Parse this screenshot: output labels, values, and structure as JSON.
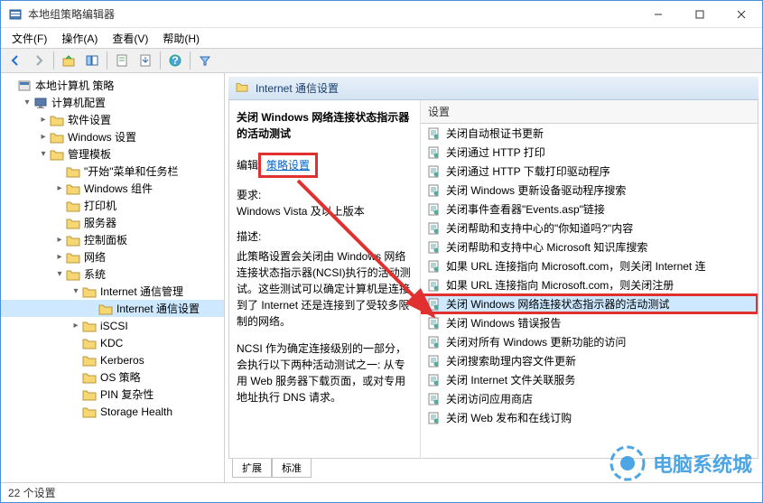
{
  "window": {
    "title": "本地组策略编辑器"
  },
  "menu": {
    "items": [
      "文件(F)",
      "操作(A)",
      "查看(V)",
      "帮助(H)"
    ]
  },
  "tree": {
    "root": "本地计算机 策略",
    "nodes": [
      {
        "indent": 0,
        "expander": " ",
        "icon": "console",
        "label": "本地计算机 策略"
      },
      {
        "indent": 1,
        "expander": "▾",
        "icon": "computer",
        "label": "计算机配置"
      },
      {
        "indent": 2,
        "expander": "▸",
        "icon": "folder",
        "label": "软件设置"
      },
      {
        "indent": 2,
        "expander": "▸",
        "icon": "folder",
        "label": "Windows 设置"
      },
      {
        "indent": 2,
        "expander": "▾",
        "icon": "folder",
        "label": "管理模板"
      },
      {
        "indent": 3,
        "expander": " ",
        "icon": "folder",
        "label": "\"开始\"菜单和任务栏"
      },
      {
        "indent": 3,
        "expander": "▸",
        "icon": "folder",
        "label": "Windows 组件"
      },
      {
        "indent": 3,
        "expander": " ",
        "icon": "folder",
        "label": "打印机"
      },
      {
        "indent": 3,
        "expander": " ",
        "icon": "folder",
        "label": "服务器"
      },
      {
        "indent": 3,
        "expander": "▸",
        "icon": "folder",
        "label": "控制面板"
      },
      {
        "indent": 3,
        "expander": "▸",
        "icon": "folder",
        "label": "网络"
      },
      {
        "indent": 3,
        "expander": "▾",
        "icon": "folder",
        "label": "系统"
      },
      {
        "indent": 4,
        "expander": "▾",
        "icon": "folder",
        "label": "Internet 通信管理"
      },
      {
        "indent": 5,
        "expander": " ",
        "icon": "folder",
        "label": "Internet 通信设置",
        "selected": true
      },
      {
        "indent": 4,
        "expander": "▸",
        "icon": "folder",
        "label": "iSCSI"
      },
      {
        "indent": 4,
        "expander": " ",
        "icon": "folder",
        "label": "KDC"
      },
      {
        "indent": 4,
        "expander": " ",
        "icon": "folder",
        "label": "Kerberos"
      },
      {
        "indent": 4,
        "expander": " ",
        "icon": "folder",
        "label": "OS 策略"
      },
      {
        "indent": 4,
        "expander": " ",
        "icon": "folder",
        "label": "PIN 复杂性"
      },
      {
        "indent": 4,
        "expander": " ",
        "icon": "folder",
        "label": "Storage Health"
      }
    ]
  },
  "details": {
    "path_label": "Internet 通信设置",
    "title": "关闭 Windows 网络连接状态指示器的活动测试",
    "edit_prefix": "编辑",
    "edit_link": "策略设置",
    "req_label": "要求:",
    "req_text": "Windows Vista 及以上版本",
    "desc_label": "描述:",
    "desc_text": "此策略设置会关闭由 Windows 网络连接状态指示器(NCSI)执行的活动测试。这些测试可以确定计算机是连接到了 Internet 还是连接到了受较多限制的网络。",
    "desc_text2": "NCSI 作为确定连接级别的一部分，会执行以下两种活动测试之一: 从专用 Web 服务器下载页面，或对专用地址执行 DNS 请求。"
  },
  "list": {
    "header": "设置",
    "items": [
      "关闭自动根证书更新",
      "关闭通过 HTTP 打印",
      "关闭通过 HTTP 下载打印驱动程序",
      "关闭 Windows 更新设备驱动程序搜索",
      "关闭事件查看器\"Events.asp\"链接",
      "关闭帮助和支持中心的\"你知道吗?\"内容",
      "关闭帮助和支持中心 Microsoft 知识库搜索",
      "如果 URL 连接指向 Microsoft.com，则关闭 Internet 连",
      "如果 URL 连接指向 Microsoft.com，则关闭注册",
      "关闭 Windows 网络连接状态指示器的活动测试",
      "关闭 Windows 错误报告",
      "关闭对所有 Windows 更新功能的访问",
      "关闭搜索助理内容文件更新",
      "关闭 Internet 文件关联服务",
      "关闭访问应用商店",
      "关闭 Web 发布和在线订购"
    ],
    "highlighted_index": 9
  },
  "tabs": {
    "items": [
      "扩展",
      "标准"
    ],
    "active": 0
  },
  "status": {
    "text": "22 个设置"
  },
  "watermark": {
    "text": "电脑系统城"
  },
  "colors": {
    "accent": "#0066cc",
    "annotation": "#e03030",
    "folder": "#f7d774"
  }
}
